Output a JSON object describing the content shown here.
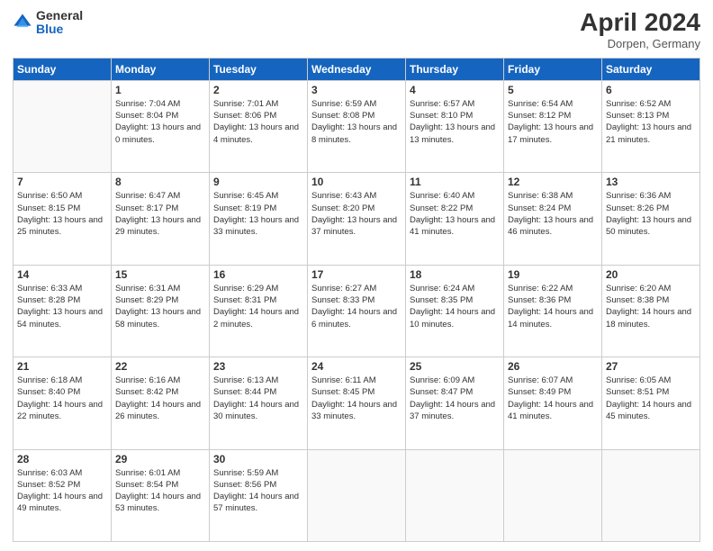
{
  "logo": {
    "general": "General",
    "blue": "Blue"
  },
  "title": "April 2024",
  "subtitle": "Dorpen, Germany",
  "days_header": [
    "Sunday",
    "Monday",
    "Tuesday",
    "Wednesday",
    "Thursday",
    "Friday",
    "Saturday"
  ],
  "weeks": [
    [
      {
        "day": "",
        "sunrise": "",
        "sunset": "",
        "daylight": ""
      },
      {
        "day": "1",
        "sunrise": "Sunrise: 7:04 AM",
        "sunset": "Sunset: 8:04 PM",
        "daylight": "Daylight: 13 hours and 0 minutes."
      },
      {
        "day": "2",
        "sunrise": "Sunrise: 7:01 AM",
        "sunset": "Sunset: 8:06 PM",
        "daylight": "Daylight: 13 hours and 4 minutes."
      },
      {
        "day": "3",
        "sunrise": "Sunrise: 6:59 AM",
        "sunset": "Sunset: 8:08 PM",
        "daylight": "Daylight: 13 hours and 8 minutes."
      },
      {
        "day": "4",
        "sunrise": "Sunrise: 6:57 AM",
        "sunset": "Sunset: 8:10 PM",
        "daylight": "Daylight: 13 hours and 13 minutes."
      },
      {
        "day": "5",
        "sunrise": "Sunrise: 6:54 AM",
        "sunset": "Sunset: 8:12 PM",
        "daylight": "Daylight: 13 hours and 17 minutes."
      },
      {
        "day": "6",
        "sunrise": "Sunrise: 6:52 AM",
        "sunset": "Sunset: 8:13 PM",
        "daylight": "Daylight: 13 hours and 21 minutes."
      }
    ],
    [
      {
        "day": "7",
        "sunrise": "Sunrise: 6:50 AM",
        "sunset": "Sunset: 8:15 PM",
        "daylight": "Daylight: 13 hours and 25 minutes."
      },
      {
        "day": "8",
        "sunrise": "Sunrise: 6:47 AM",
        "sunset": "Sunset: 8:17 PM",
        "daylight": "Daylight: 13 hours and 29 minutes."
      },
      {
        "day": "9",
        "sunrise": "Sunrise: 6:45 AM",
        "sunset": "Sunset: 8:19 PM",
        "daylight": "Daylight: 13 hours and 33 minutes."
      },
      {
        "day": "10",
        "sunrise": "Sunrise: 6:43 AM",
        "sunset": "Sunset: 8:20 PM",
        "daylight": "Daylight: 13 hours and 37 minutes."
      },
      {
        "day": "11",
        "sunrise": "Sunrise: 6:40 AM",
        "sunset": "Sunset: 8:22 PM",
        "daylight": "Daylight: 13 hours and 41 minutes."
      },
      {
        "day": "12",
        "sunrise": "Sunrise: 6:38 AM",
        "sunset": "Sunset: 8:24 PM",
        "daylight": "Daylight: 13 hours and 46 minutes."
      },
      {
        "day": "13",
        "sunrise": "Sunrise: 6:36 AM",
        "sunset": "Sunset: 8:26 PM",
        "daylight": "Daylight: 13 hours and 50 minutes."
      }
    ],
    [
      {
        "day": "14",
        "sunrise": "Sunrise: 6:33 AM",
        "sunset": "Sunset: 8:28 PM",
        "daylight": "Daylight: 13 hours and 54 minutes."
      },
      {
        "day": "15",
        "sunrise": "Sunrise: 6:31 AM",
        "sunset": "Sunset: 8:29 PM",
        "daylight": "Daylight: 13 hours and 58 minutes."
      },
      {
        "day": "16",
        "sunrise": "Sunrise: 6:29 AM",
        "sunset": "Sunset: 8:31 PM",
        "daylight": "Daylight: 14 hours and 2 minutes."
      },
      {
        "day": "17",
        "sunrise": "Sunrise: 6:27 AM",
        "sunset": "Sunset: 8:33 PM",
        "daylight": "Daylight: 14 hours and 6 minutes."
      },
      {
        "day": "18",
        "sunrise": "Sunrise: 6:24 AM",
        "sunset": "Sunset: 8:35 PM",
        "daylight": "Daylight: 14 hours and 10 minutes."
      },
      {
        "day": "19",
        "sunrise": "Sunrise: 6:22 AM",
        "sunset": "Sunset: 8:36 PM",
        "daylight": "Daylight: 14 hours and 14 minutes."
      },
      {
        "day": "20",
        "sunrise": "Sunrise: 6:20 AM",
        "sunset": "Sunset: 8:38 PM",
        "daylight": "Daylight: 14 hours and 18 minutes."
      }
    ],
    [
      {
        "day": "21",
        "sunrise": "Sunrise: 6:18 AM",
        "sunset": "Sunset: 8:40 PM",
        "daylight": "Daylight: 14 hours and 22 minutes."
      },
      {
        "day": "22",
        "sunrise": "Sunrise: 6:16 AM",
        "sunset": "Sunset: 8:42 PM",
        "daylight": "Daylight: 14 hours and 26 minutes."
      },
      {
        "day": "23",
        "sunrise": "Sunrise: 6:13 AM",
        "sunset": "Sunset: 8:44 PM",
        "daylight": "Daylight: 14 hours and 30 minutes."
      },
      {
        "day": "24",
        "sunrise": "Sunrise: 6:11 AM",
        "sunset": "Sunset: 8:45 PM",
        "daylight": "Daylight: 14 hours and 33 minutes."
      },
      {
        "day": "25",
        "sunrise": "Sunrise: 6:09 AM",
        "sunset": "Sunset: 8:47 PM",
        "daylight": "Daylight: 14 hours and 37 minutes."
      },
      {
        "day": "26",
        "sunrise": "Sunrise: 6:07 AM",
        "sunset": "Sunset: 8:49 PM",
        "daylight": "Daylight: 14 hours and 41 minutes."
      },
      {
        "day": "27",
        "sunrise": "Sunrise: 6:05 AM",
        "sunset": "Sunset: 8:51 PM",
        "daylight": "Daylight: 14 hours and 45 minutes."
      }
    ],
    [
      {
        "day": "28",
        "sunrise": "Sunrise: 6:03 AM",
        "sunset": "Sunset: 8:52 PM",
        "daylight": "Daylight: 14 hours and 49 minutes."
      },
      {
        "day": "29",
        "sunrise": "Sunrise: 6:01 AM",
        "sunset": "Sunset: 8:54 PM",
        "daylight": "Daylight: 14 hours and 53 minutes."
      },
      {
        "day": "30",
        "sunrise": "Sunrise: 5:59 AM",
        "sunset": "Sunset: 8:56 PM",
        "daylight": "Daylight: 14 hours and 57 minutes."
      },
      {
        "day": "",
        "sunrise": "",
        "sunset": "",
        "daylight": ""
      },
      {
        "day": "",
        "sunrise": "",
        "sunset": "",
        "daylight": ""
      },
      {
        "day": "",
        "sunrise": "",
        "sunset": "",
        "daylight": ""
      },
      {
        "day": "",
        "sunrise": "",
        "sunset": "",
        "daylight": ""
      }
    ]
  ]
}
